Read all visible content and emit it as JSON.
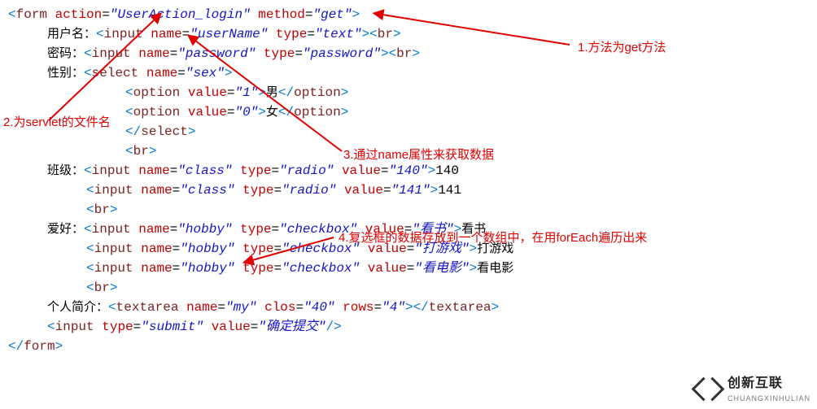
{
  "tokens": {
    "lt": "<",
    "gt": ">",
    "et": "</",
    "sc": "/>",
    "eq": "="
  },
  "tags": {
    "form": "form",
    "input": "input",
    "br": "br",
    "select": "select",
    "option": "option",
    "textarea": "textarea"
  },
  "attrs": {
    "action": "action",
    "method": "method",
    "name": "name",
    "type": "type",
    "value": "value",
    "clos": "clos",
    "rows": "rows"
  },
  "vals": {
    "action": "\"UserAction_login\"",
    "method": "\"get\"",
    "userName": "\"userName\"",
    "text": "\"text\"",
    "password": "\"password\"",
    "passwordType": "\"password\"",
    "sex": "\"sex\"",
    "one": "\"1\"",
    "zero": "\"0\"",
    "classN": "\"class\"",
    "radio": "\"radio\"",
    "v140": "\"140\"",
    "v141": "\"141\"",
    "hobby": "\"hobby\"",
    "checkbox": "\"checkbox\"",
    "vRead": "\"看书\"",
    "vGame": "\"打游戏\"",
    "vMovie": "\"看电影\"",
    "my": "\"my\"",
    "c40": "\"40\"",
    "r4": "\"4\"",
    "submit": "\"submit\"",
    "submitLabel": "\"确定提交\""
  },
  "labels": {
    "user": "用户名：",
    "pwd": "密码：",
    "sex": "性别：",
    "male": "男",
    "female": "女",
    "class": "班级：",
    "v140": "140",
    "v141": "141",
    "hobby": "爱好：",
    "read": "看书",
    "game": "打游戏",
    "movie": "看电影",
    "bio": "个人简介："
  },
  "annotations": {
    "a1": "1.方法为get方法",
    "a2": "2.为servlet的文件名",
    "a3": "3.通过name属性来获取数据",
    "a4": "4.复选框的数据存放到一个数组中，在用forEach遍历出来"
  },
  "brand": {
    "name": "创新互联",
    "sub": "CHUANGXINHULIAN"
  }
}
